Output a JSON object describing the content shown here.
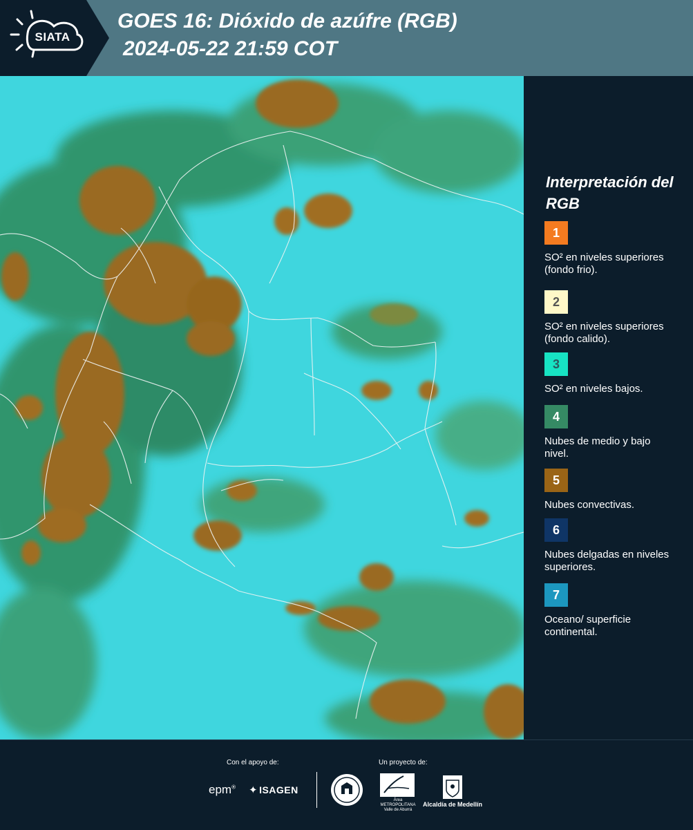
{
  "header": {
    "logo_text": "SIATA",
    "title_line1": "GOES 16: Dióxido de azúfre (RGB)",
    "title_line2": "2024-05-22 21:59 COT"
  },
  "legend": {
    "title": "Interpretación del RGB",
    "items": [
      {
        "number": "1",
        "label": "SO² en niveles superiores (fondo frio).",
        "color": "#f47b20",
        "text_color": "#ffffff"
      },
      {
        "number": "2",
        "label": "SO² en niveles superiores (fondo calido).",
        "color": "#fff8c8",
        "text_color": "#555555"
      },
      {
        "number": "3",
        "label": "SO² en niveles bajos.",
        "color": "#17e3c3",
        "text_color": "#2a5a60"
      },
      {
        "number": "4",
        "label": "Nubes de medio y bajo nivel.",
        "color": "#358a64",
        "text_color": "#ffffff"
      },
      {
        "number": "5",
        "label": "Nubes convectivas.",
        "color": "#9a6416",
        "text_color": "#ffffff"
      },
      {
        "number": "6",
        "label": "Nubes delgadas en niveles superiores.",
        "color": "#0f3566",
        "text_color": "#ffffff"
      },
      {
        "number": "7",
        "label": "Oceano/ superficie continental.",
        "color": "#1c97bf",
        "text_color": "#ffffff"
      }
    ]
  },
  "footer": {
    "support_caption": "Con el apoyo de:",
    "project_caption": "Un proyecto de:",
    "epm_logo": "epm",
    "isagen_logo": "ISAGEN",
    "area_logo_name": "Área",
    "area_logo_sub": "METROPOLITANA Valle de Aburrá",
    "medellin_logo": "Alcaldía de Medellín"
  },
  "map": {
    "ocean_color": "#3fd6de",
    "convective_color": "#9a6a22",
    "midlevel_color": "#2f8a5a",
    "border_color": "#f0f4f4"
  }
}
